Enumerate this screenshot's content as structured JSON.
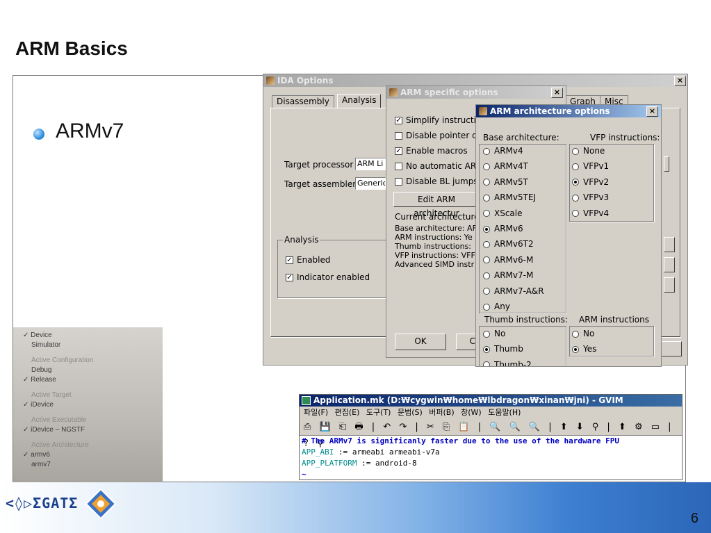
{
  "slide": {
    "title": "ARM Basics",
    "bullet": "ARMv7",
    "page_number": "6",
    "logo_text": "<◊▷ΣGATΣ"
  },
  "ida_options": {
    "title": "IDA Options",
    "close": "×",
    "tabs": [
      "Disassembly",
      "Analysis",
      "Graph",
      "Misc"
    ],
    "target_processor_label": "Target processor",
    "target_processor_value": "ARM Li",
    "target_assembler_label": "Target assembler",
    "target_assembler_value": "Generic",
    "analysis_group": "Analysis",
    "enabled": "Enabled",
    "indicator_enabled": "Indicator enabled"
  },
  "arm_specific": {
    "title": "ARM specific options",
    "close": "×",
    "options": [
      {
        "label": "Simplify instructio",
        "checked": true
      },
      {
        "label": "Disable pointer de",
        "checked": false
      },
      {
        "label": "Enable macros",
        "checked": true
      },
      {
        "label": "No automatic ARM",
        "checked": false
      },
      {
        "label": "Disable BL jumps",
        "checked": false
      }
    ],
    "edit_button": "Edit ARM architectur",
    "current_arch": "Current architecture:",
    "info": [
      "Base architecture: AF",
      "ARM instructions: Ye",
      "Thumb instructions: ",
      "VFP instructions: VFF",
      "Advanced SIMD instr"
    ],
    "ok": "OK",
    "cancel": "Car"
  },
  "arm_arch": {
    "title": "ARM architecture options",
    "close": "×",
    "base_label": "Base architecture:",
    "vfp_label": "VFP instructions:",
    "base": [
      "ARMv4",
      "ARMv4T",
      "ARMv5T",
      "ARMv5TEJ",
      "XScale",
      "ARMv6",
      "ARMv6T2",
      "ARMv6-M",
      "ARMv7-M",
      "ARMv7-A&R",
      "Any"
    ],
    "base_selected": "ARMv6",
    "vfp": [
      "None",
      "VFPv1",
      "VFPv2",
      "VFPv3",
      "VFPv4"
    ],
    "vfp_selected": "VFPv2",
    "thumb_label": "Thumb instructions:",
    "thumb": [
      "No",
      "Thumb",
      "Thumb-2"
    ],
    "thumb_selected": "Thumb",
    "arm_label": "ARM instructions",
    "arm": [
      "No",
      "Yes"
    ],
    "arm_selected": "Yes"
  },
  "xcode_menu": {
    "items": [
      {
        "text": "✓ Device",
        "dim": false
      },
      {
        "text": "Simulator",
        "dim": false
      },
      {
        "text": "Active Configuration",
        "dim": true
      },
      {
        "text": "Debug",
        "dim": false
      },
      {
        "text": "✓ Release",
        "dim": false
      },
      {
        "text": "Active Target",
        "dim": true
      },
      {
        "text": "✓ iDevice",
        "dim": false
      },
      {
        "text": "Active Executable",
        "dim": true
      },
      {
        "text": "✓ iDevice – NGSTF",
        "dim": false
      },
      {
        "text": "Active Architecture",
        "dim": true
      },
      {
        "text": "✓ armv6",
        "dim": false
      },
      {
        "text": "armv7",
        "dim": false
      }
    ]
  },
  "gvim": {
    "title": "Application.mk (D:₩cygwin₩home₩lbdragon₩xinan₩jni) - GVIM",
    "menu": "파일(F) 편집(E) 도구(T) 문법(S) 버퍼(B) 창(W) 도움말(H)",
    "toolbar": "⎙ 💾 ⎗ 🖶 | ↶ ↷ | ✂ ⎘ 📋 | 🔍 🔍 🔍 | ⬆ ⬇ ⚲ | ⬆ ⚙ ▭ | ? ⚲",
    "lines": [
      {
        "kind": "comment",
        "text": "# The ARMv7 is significanly faster due to the use of the hardware FPU"
      },
      {
        "kind": "assign",
        "var": "APP_ABI",
        "val": " := armeabi armeabi-v7a"
      },
      {
        "kind": "assign",
        "var": "APP_PLATFORM",
        "val": " := android-8"
      },
      {
        "kind": "tilde",
        "text": "~"
      }
    ]
  },
  "colors": {
    "comment": "#0000c0",
    "var": "#008b8b",
    "titlebar_active": "#0a246a",
    "bullet": "#2f8fe0"
  }
}
